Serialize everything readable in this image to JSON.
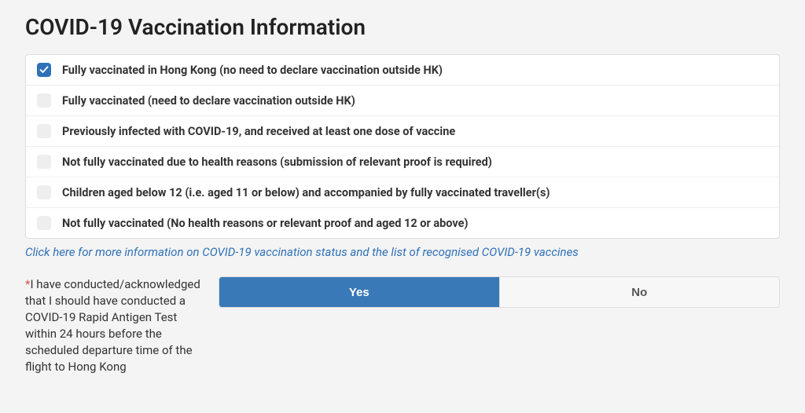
{
  "title": "COVID-19 Vaccination Information",
  "options": [
    {
      "label": "Fully vaccinated in Hong Kong (no need to declare vaccination outside HK)",
      "checked": true
    },
    {
      "label": "Fully vaccinated (need to declare vaccination outside HK)",
      "checked": false
    },
    {
      "label": "Previously infected with COVID-19, and received at least one dose of vaccine",
      "checked": false
    },
    {
      "label": "Not fully vaccinated due to health reasons (submission of relevant proof is required)",
      "checked": false
    },
    {
      "label": "Children aged below 12 (i.e. aged 11 or below) and accompanied by fully vaccinated traveller(s)",
      "checked": false
    },
    {
      "label": "Not fully vaccinated (No health reasons or relevant proof and aged 12 or above)",
      "checked": false
    }
  ],
  "info_link": "Click here for more information on COVID-19 vaccination status and the list of recognised COVID-19 vaccines",
  "rat_question": {
    "required_mark": "*",
    "text": "I have conducted/acknowledged that I should have conducted a COVID-19 Rapid Antigen Test within 24 hours before the scheduled departure time of the flight to Hong Kong",
    "yes_label": "Yes",
    "no_label": "No",
    "selected": "yes"
  }
}
